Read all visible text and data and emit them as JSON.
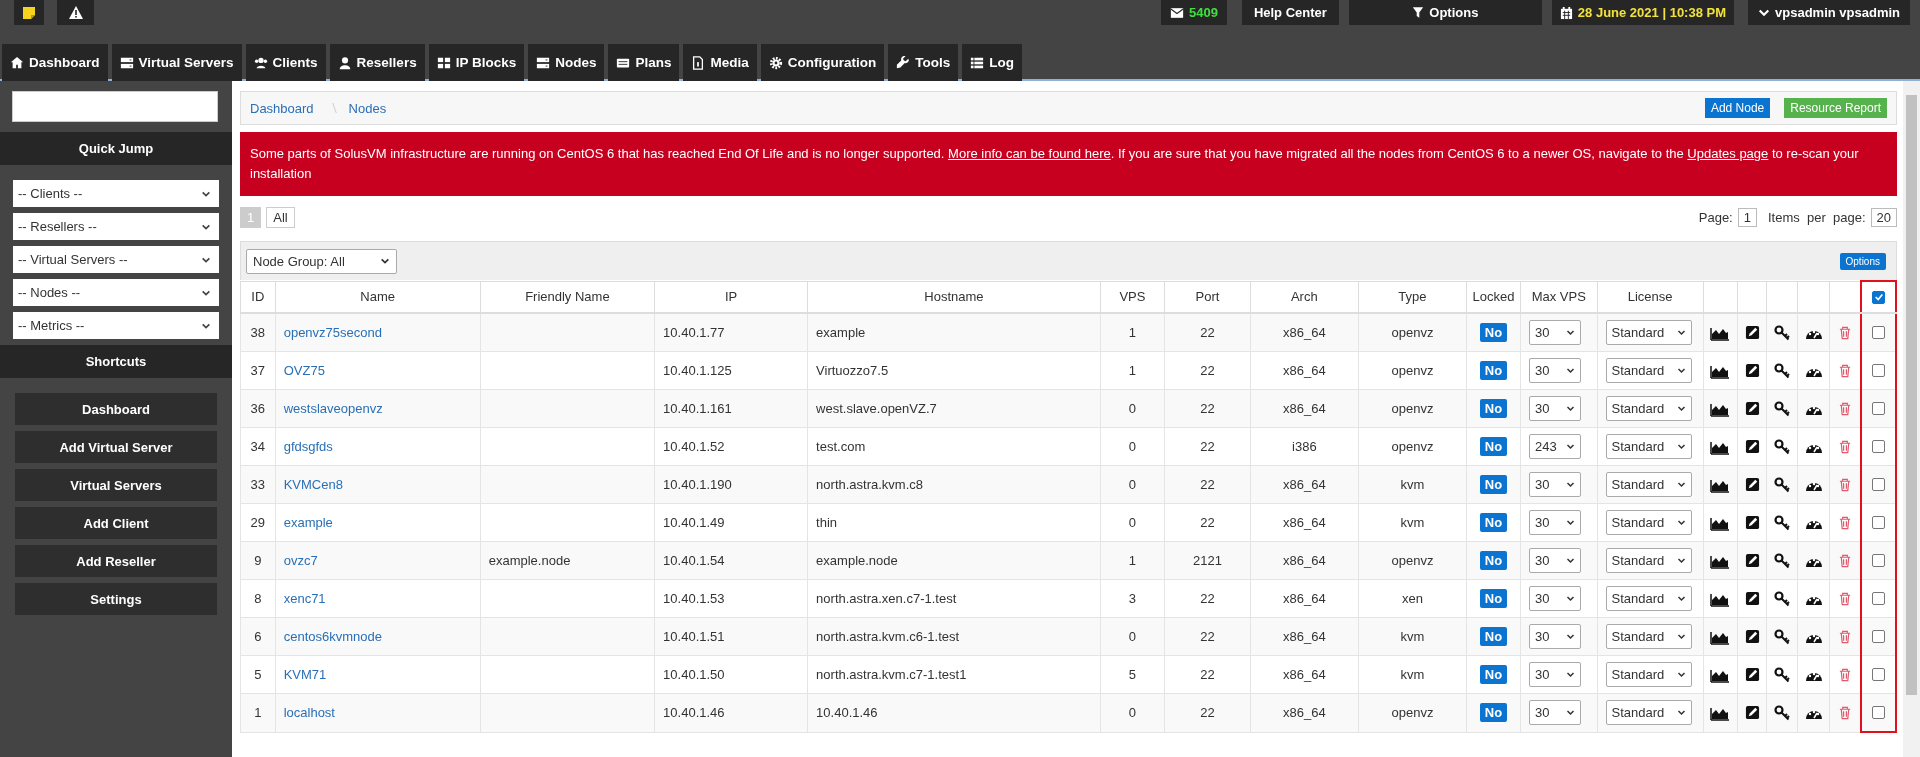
{
  "top_bar": {
    "message_count": "5409",
    "help": "Help Center",
    "options": "Options",
    "datetime": "28 June 2021 | 10:38 PM",
    "user": "vpsadmin vpsadmin"
  },
  "nav_tabs": [
    {
      "label": "Dashboard",
      "selected": false
    },
    {
      "label": "Virtual Servers",
      "selected": false
    },
    {
      "label": "Clients",
      "selected": false
    },
    {
      "label": "Resellers",
      "selected": false
    },
    {
      "label": "IP Blocks",
      "selected": false
    },
    {
      "label": "Nodes",
      "selected": false
    },
    {
      "label": "Plans",
      "selected": false
    },
    {
      "label": "Media",
      "selected": false
    },
    {
      "label": "Configuration",
      "selected": false
    },
    {
      "label": "Tools",
      "selected": false
    },
    {
      "label": "Log",
      "selected": false
    }
  ],
  "sidebar": {
    "quick_jump_title": "Quick Jump",
    "quick_jump": [
      "-- Clients --",
      "-- Resellers --",
      "-- Virtual Servers --",
      "-- Nodes --",
      "-- Metrics --"
    ],
    "shortcuts_title": "Shortcuts",
    "shortcuts": [
      "Dashboard",
      "Add Virtual Server",
      "Virtual Servers",
      "Add Client",
      "Add Reseller",
      "Settings"
    ]
  },
  "breadcrumb": [
    "Dashboard",
    "Nodes"
  ],
  "header_buttons": [
    {
      "label": "Add Node",
      "color": "#0a74d0"
    },
    {
      "label": "Resource Report",
      "color": "#56b24c"
    }
  ],
  "alert": [
    {
      "kind": "text",
      "text": "Some parts of SolusVM infrastructure are running on CentOS 6 that has reached End Of Life and is no longer supported. "
    },
    {
      "kind": "link",
      "text": "More info can be found here"
    },
    {
      "kind": "text",
      "text": ". If you are sure that you have migrated all the nodes from CentOS 6 to a newer OS, navigate to the "
    },
    {
      "kind": "link",
      "text": "Updates page"
    },
    {
      "kind": "text",
      "text": " to re-scan your installation"
    }
  ],
  "pagination": {
    "pages": [
      {
        "label": "1",
        "selected": true
      },
      {
        "label": "All",
        "selected": false
      }
    ],
    "page_label": "Page:",
    "page": "1",
    "items_label": "Items  per  page:",
    "items": "20"
  },
  "node_group": "Node Group: All",
  "options_button": "Options",
  "table": {
    "columns": [
      "ID",
      "Name",
      "Friendly Name",
      "IP",
      "Hostname",
      "VPS",
      "Port",
      "Arch",
      "Type",
      "Locked",
      "Max VPS",
      "License"
    ],
    "select_all_checked": true,
    "rows": [
      {
        "id": "38",
        "name": "openvz75second",
        "friendly_name": "",
        "ip": "10.40.1.77",
        "hostname": "example",
        "vps": "1",
        "port": "22",
        "arch": "x86_64",
        "type": "openvz",
        "locked": "No",
        "max_vps": "30",
        "license": "Standard",
        "checked": false
      },
      {
        "id": "37",
        "name": "OVZ75",
        "friendly_name": "",
        "ip": "10.40.1.125",
        "hostname": "Virtuozzo7.5",
        "vps": "1",
        "port": "22",
        "arch": "x86_64",
        "type": "openvz",
        "locked": "No",
        "max_vps": "30",
        "license": "Standard",
        "checked": false
      },
      {
        "id": "36",
        "name": "westslaveopenvz",
        "friendly_name": "",
        "ip": "10.40.1.161",
        "hostname": "west.slave.openVZ.7",
        "vps": "0",
        "port": "22",
        "arch": "x86_64",
        "type": "openvz",
        "locked": "No",
        "max_vps": "30",
        "license": "Standard",
        "checked": false
      },
      {
        "id": "34",
        "name": "gfdsgfds",
        "friendly_name": "",
        "ip": "10.40.1.52",
        "hostname": "test.com",
        "vps": "0",
        "port": "22",
        "arch": "i386",
        "type": "openvz",
        "locked": "No",
        "max_vps": "243",
        "license": "Standard",
        "checked": false
      },
      {
        "id": "33",
        "name": "KVMCen8",
        "friendly_name": "",
        "ip": "10.40.1.190",
        "hostname": "north.astra.kvm.c8",
        "vps": "0",
        "port": "22",
        "arch": "x86_64",
        "type": "kvm",
        "locked": "No",
        "max_vps": "30",
        "license": "Standard",
        "checked": false
      },
      {
        "id": "29",
        "name": "example",
        "friendly_name": "",
        "ip": "10.40.1.49",
        "hostname": "thin",
        "vps": "0",
        "port": "22",
        "arch": "x86_64",
        "type": "kvm",
        "locked": "No",
        "max_vps": "30",
        "license": "Standard",
        "checked": false
      },
      {
        "id": "9",
        "name": "ovzc7",
        "friendly_name": "example.node",
        "ip": "10.40.1.54",
        "hostname": "example.node",
        "vps": "1",
        "port": "2121",
        "arch": "x86_64",
        "type": "openvz",
        "locked": "No",
        "max_vps": "30",
        "license": "Standard",
        "checked": false
      },
      {
        "id": "8",
        "name": "xenc71",
        "friendly_name": "",
        "ip": "10.40.1.53",
        "hostname": "north.astra.xen.c7-1.test",
        "vps": "3",
        "port": "22",
        "arch": "x86_64",
        "type": "xen",
        "locked": "No",
        "max_vps": "30",
        "license": "Standard",
        "checked": false
      },
      {
        "id": "6",
        "name": "centos6kvmnode",
        "friendly_name": "",
        "ip": "10.40.1.51",
        "hostname": "north.astra.kvm.c6-1.test",
        "vps": "0",
        "port": "22",
        "arch": "x86_64",
        "type": "kvm",
        "locked": "No",
        "max_vps": "30",
        "license": "Standard",
        "checked": false
      },
      {
        "id": "5",
        "name": "KVM71",
        "friendly_name": "",
        "ip": "10.40.1.50",
        "hostname": "north.astra.kvm.c7-1.test1",
        "vps": "5",
        "port": "22",
        "arch": "x86_64",
        "type": "kvm",
        "locked": "No",
        "max_vps": "30",
        "license": "Standard",
        "checked": false
      },
      {
        "id": "1",
        "name": "localhost",
        "friendly_name": "",
        "ip": "10.40.1.46",
        "hostname": "10.40.1.46",
        "vps": "0",
        "port": "22",
        "arch": "x86_64",
        "type": "openvz",
        "locked": "No",
        "max_vps": "30",
        "license": "Standard",
        "checked": false
      }
    ]
  }
}
